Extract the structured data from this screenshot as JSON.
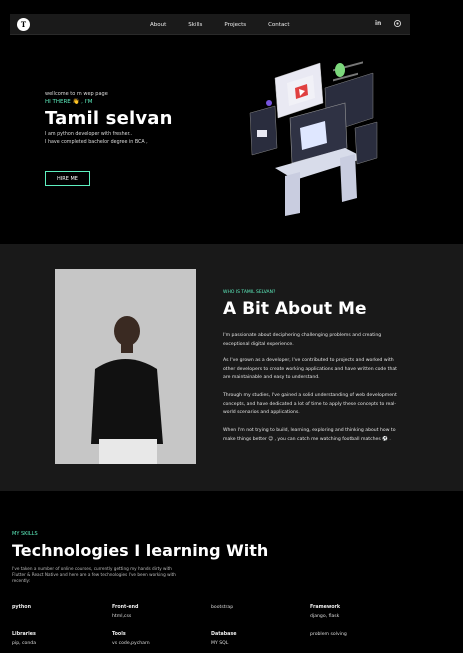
{
  "nav": {
    "logo_text": "T",
    "links": [
      "About",
      "Skills",
      "Projects",
      "Contact"
    ],
    "linkedin_icon": "in",
    "github_icon_name": "github-icon"
  },
  "hero": {
    "welcome": "wellcome to m wep page",
    "hi": "HI THERE 👋 , I'M",
    "name": "Tamil selvan",
    "line1": "I am python developer with fresher..",
    "line2": "I have completed bachelor degree in BCA ,",
    "hire_label": "HIRE ME"
  },
  "about": {
    "kicker": "WHO IS TAMIL SELVAN?",
    "title": "A Bit About Me",
    "p1": "I'm passionate about deciphering challenging problems and creating exceptional digital experience.",
    "p2": "As I've grown as a developer, I've contributed to projects and worked with other developers to create working applications and have written code that are maintainable and easy to understand.",
    "p3": "Through my studies, I've gained a solid understanding of web development concepts, and have dedicated a lot of time to apply these concepts to real-world scenarios and applications.",
    "p4": "When I'm not trying to build, learning, exploring and thinking about how to make things better 😉 , you can catch me watching football matches ⚽ ."
  },
  "skills": {
    "kicker": "MY SKILLS",
    "title": "Technologies I learning With",
    "desc": "I've taken a number of online courses, currently getting my hands dirty with Flutter & React Native and here are a few technologies I've been working with recently:",
    "row1": [
      {
        "head": "python",
        "val": ""
      },
      {
        "head": "Front-end",
        "val": "html,css"
      },
      {
        "head": "",
        "val": "bootstrap"
      },
      {
        "head": "Framework",
        "val": "django, flask"
      }
    ],
    "row2": [
      {
        "head": "Libraries",
        "val": "pip, conda"
      },
      {
        "head": "Tools",
        "val": "vs code,pycharn"
      },
      {
        "head": "Database",
        "val": "MY SQL"
      },
      {
        "head": "",
        "val": "problem solving"
      }
    ]
  },
  "colors": {
    "accent": "#5ef0c0",
    "background": "#000000",
    "section_alt": "#191919"
  }
}
